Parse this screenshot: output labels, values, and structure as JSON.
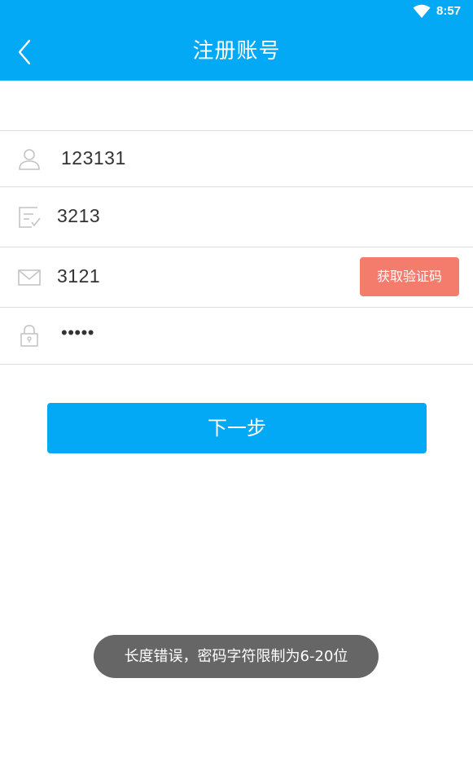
{
  "status_bar": {
    "time": "8:57"
  },
  "header": {
    "title": "注册账号"
  },
  "form": {
    "username": {
      "value": "123131"
    },
    "nickname": {
      "value": "3213"
    },
    "email": {
      "value": "3121",
      "get_code_label": "获取验证码"
    },
    "password": {
      "value": "•••••"
    }
  },
  "next_button": {
    "label": "下一步"
  },
  "toast": {
    "message": "长度错误，密码字符限制为6-20位"
  },
  "colors": {
    "primary": "#03a9f4",
    "code_button": "#f47c6c",
    "toast_bg": "#666666"
  }
}
